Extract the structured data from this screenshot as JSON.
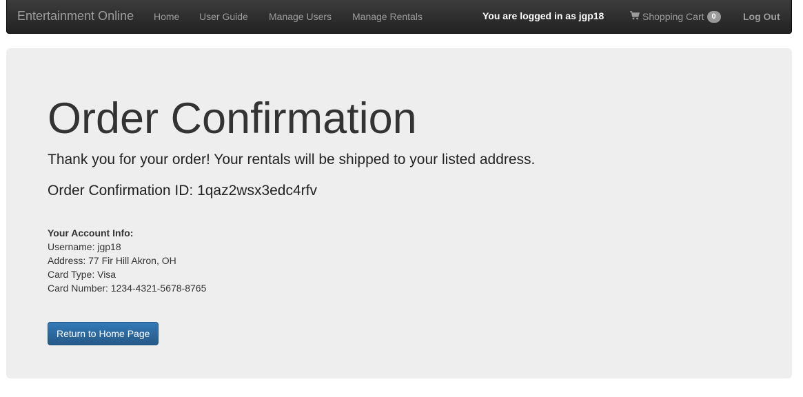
{
  "navbar": {
    "brand": "Entertainment Online",
    "links": [
      {
        "label": "Home"
      },
      {
        "label": "User Guide"
      },
      {
        "label": "Manage Users"
      },
      {
        "label": "Manage Rentals"
      }
    ],
    "logged_in_text": "You are logged in as jgp18",
    "cart_label": "Shopping Cart",
    "cart_count": "0",
    "cart_icon": "shopping-cart-icon",
    "logout_label": "Log Out"
  },
  "main": {
    "title": "Order Confirmation",
    "thank_you": "Thank you for your order! Your rentals will be shipped to your listed address.",
    "confirmation_id": "Order Confirmation ID: 1qaz2wsx3edc4rfv",
    "account": {
      "heading": "Your Account Info:",
      "rows": [
        "Username: jgp18",
        "Address: 77 Fir Hill Akron, OH",
        "Card Type: Visa",
        "Card Number: 1234-4321-5678-8765"
      ]
    },
    "return_button": "Return to Home Page"
  },
  "colors": {
    "navbar_bg": "#222222",
    "jumbotron_bg": "#eeeeee",
    "button_primary": "#337ab7"
  }
}
